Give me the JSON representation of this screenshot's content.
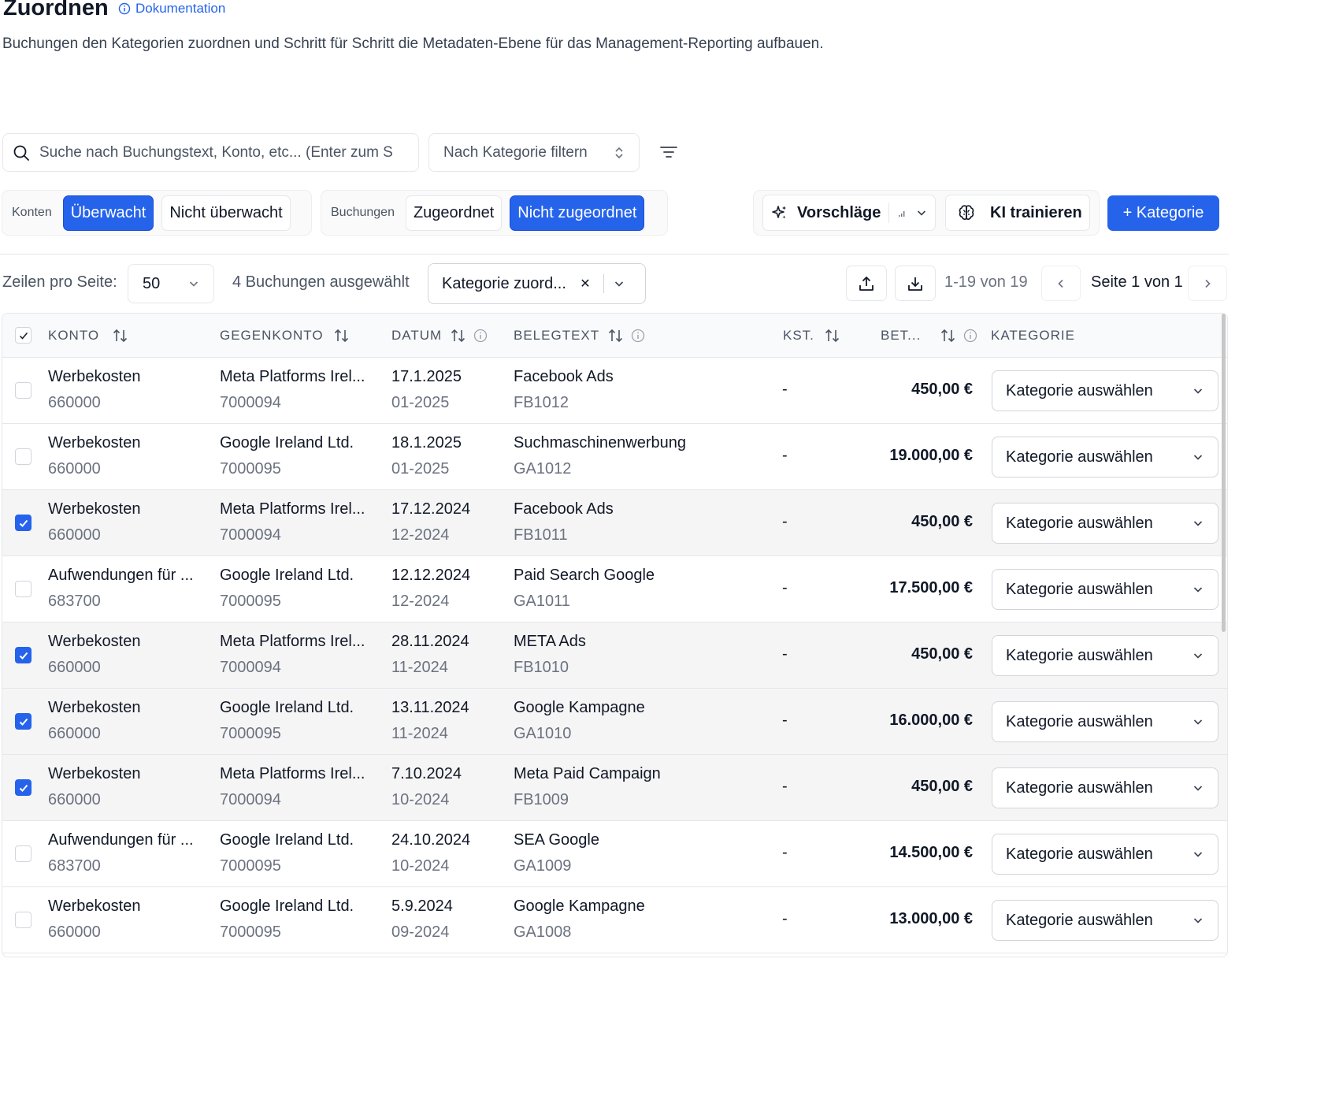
{
  "header": {
    "title": "Zuordnen",
    "doc_link": "Dokumentation",
    "subtitle": "Buchungen den Kategorien zuordnen und Schritt für Schritt die Metadaten-Ebene für das Management-Reporting aufbauen."
  },
  "search": {
    "placeholder": "Suche nach Buchungstext, Konto, etc... (Enter zum Suchen)"
  },
  "category_filter": {
    "label": "Nach Kategorie filtern"
  },
  "konten": {
    "label": "Konten",
    "options": [
      "Überwacht",
      "Nicht überwacht"
    ]
  },
  "buchungen": {
    "label": "Buchungen",
    "options": [
      "Zugeordnet",
      "Nicht zugeordnet"
    ]
  },
  "actions": {
    "vorschlaege": "Vorschläge",
    "ki_trainieren": "KI trainieren",
    "add_category": "+ Kategorie"
  },
  "pagination": {
    "rows_label": "Zeilen pro Seite:",
    "rows_value": "50",
    "selected_count": "4 Buchungen ausgewählt",
    "assign_select": "Kategorie zuord...",
    "range": "1-19 von 19",
    "page": "Seite 1 von 1"
  },
  "table": {
    "columns": [
      "KONTO",
      "GEGENKONTO",
      "DATUM",
      "BELEGTEXT",
      "KST.",
      "BET...",
      "KATEGORIE"
    ],
    "rows": [
      {
        "konto": "Werbekosten",
        "konto_nr": "660000",
        "gegenkonto": "Meta Platforms Irel...",
        "gegenkonto_nr": "7000094",
        "datum": "17.1.2025",
        "periode": "01-2025",
        "belegtext": "Facebook Ads",
        "beleg_nr": "FB1012",
        "kst": "-",
        "betrag": "450,00 €",
        "kategorie": "Kategorie auswählen",
        "selected": false
      },
      {
        "konto": "Werbekosten",
        "konto_nr": "660000",
        "gegenkonto": "Google Ireland Ltd.",
        "gegenkonto_nr": "7000095",
        "datum": "18.1.2025",
        "periode": "01-2025",
        "belegtext": "Suchmaschinenwerbung",
        "beleg_nr": "GA1012",
        "kst": "-",
        "betrag": "19.000,00 €",
        "kategorie": "Kategorie auswählen",
        "selected": false
      },
      {
        "konto": "Werbekosten",
        "konto_nr": "660000",
        "gegenkonto": "Meta Platforms Irel...",
        "gegenkonto_nr": "7000094",
        "datum": "17.12.2024",
        "periode": "12-2024",
        "belegtext": "Facebook Ads",
        "beleg_nr": "FB1011",
        "kst": "-",
        "betrag": "450,00 €",
        "kategorie": "Kategorie auswählen",
        "selected": true
      },
      {
        "konto": "Aufwendungen für ...",
        "konto_nr": "683700",
        "gegenkonto": "Google Ireland Ltd.",
        "gegenkonto_nr": "7000095",
        "datum": "12.12.2024",
        "periode": "12-2024",
        "belegtext": "Paid Search Google",
        "beleg_nr": "GA1011",
        "kst": "-",
        "betrag": "17.500,00 €",
        "kategorie": "Kategorie auswählen",
        "selected": false
      },
      {
        "konto": "Werbekosten",
        "konto_nr": "660000",
        "gegenkonto": "Meta Platforms Irel...",
        "gegenkonto_nr": "7000094",
        "datum": "28.11.2024",
        "periode": "11-2024",
        "belegtext": "META Ads",
        "beleg_nr": "FB1010",
        "kst": "-",
        "betrag": "450,00 €",
        "kategorie": "Kategorie auswählen",
        "selected": true
      },
      {
        "konto": "Werbekosten",
        "konto_nr": "660000",
        "gegenkonto": "Google Ireland Ltd.",
        "gegenkonto_nr": "7000095",
        "datum": "13.11.2024",
        "periode": "11-2024",
        "belegtext": "Google Kampagne",
        "beleg_nr": "GA1010",
        "kst": "-",
        "betrag": "16.000,00 €",
        "kategorie": "Kategorie auswählen",
        "selected": true
      },
      {
        "konto": "Werbekosten",
        "konto_nr": "660000",
        "gegenkonto": "Meta Platforms Irel...",
        "gegenkonto_nr": "7000094",
        "datum": "7.10.2024",
        "periode": "10-2024",
        "belegtext": "Meta Paid Campaign",
        "beleg_nr": "FB1009",
        "kst": "-",
        "betrag": "450,00 €",
        "kategorie": "Kategorie auswählen",
        "selected": true
      },
      {
        "konto": "Aufwendungen für ...",
        "konto_nr": "683700",
        "gegenkonto": "Google Ireland Ltd.",
        "gegenkonto_nr": "7000095",
        "datum": "24.10.2024",
        "periode": "10-2024",
        "belegtext": "SEA Google",
        "beleg_nr": "GA1009",
        "kst": "-",
        "betrag": "14.500,00 €",
        "kategorie": "Kategorie auswählen",
        "selected": false
      },
      {
        "konto": "Werbekosten",
        "konto_nr": "660000",
        "gegenkonto": "Google Ireland Ltd.",
        "gegenkonto_nr": "7000095",
        "datum": "5.9.2024",
        "periode": "09-2024",
        "belegtext": "Google Kampagne",
        "beleg_nr": "GA1008",
        "kst": "-",
        "betrag": "13.000,00 €",
        "kategorie": "Kategorie auswählen",
        "selected": false
      }
    ]
  },
  "colors": {
    "accent": "#2563eb",
    "border": "#e5e7eb",
    "text": "#111827",
    "muted": "#6b7280"
  }
}
